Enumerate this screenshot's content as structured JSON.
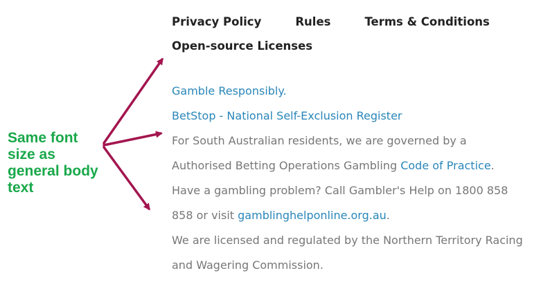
{
  "annotation": {
    "text": "Same font\nsize as\ngeneral body\ntext",
    "color": "#19a84a"
  },
  "footer": {
    "nav": {
      "privacy": "Privacy Policy",
      "rules": "Rules",
      "terms": "Terms & Conditions",
      "licenses": "Open-source Licenses"
    },
    "links": {
      "gamble_responsibly": "Gamble Responsibly.",
      "betstop": "BetStop - National Self-Exclusion Register"
    },
    "body": {
      "sa_line1": "For South Australian residents, we are governed by a",
      "sa_line2_prefix": "Authorised Betting Operations Gambling ",
      "sa_line2_link": "Code of Practice",
      "sa_line2_suffix": ".",
      "help_line1": "Have a gambling problem? Call Gambler's Help on 1800 858",
      "help_line2_prefix": "858 or visit ",
      "help_line2_link": "gamblinghelponline.org.au",
      "help_line2_suffix": ".",
      "license_line1": "We are licensed and regulated by the Northern Territory Racing",
      "license_line2": "and Wagering Commission."
    },
    "colors": {
      "link": "#2a86b9",
      "body": "#777777",
      "heading": "#222222",
      "arrow": "#a3154f"
    }
  }
}
